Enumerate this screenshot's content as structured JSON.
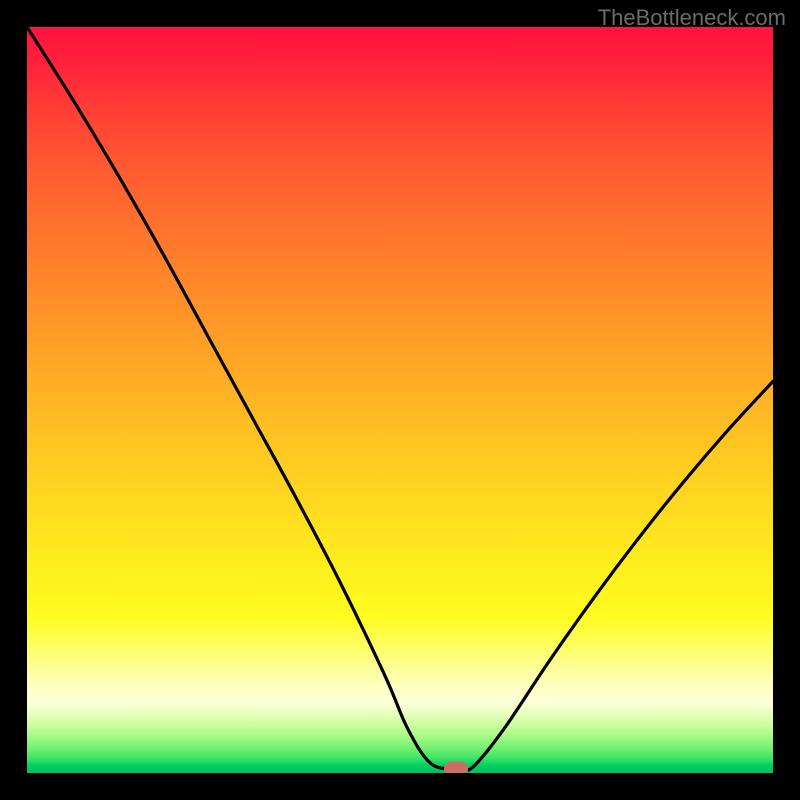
{
  "watermark": "TheBottleneck.com",
  "chart_data": {
    "type": "line",
    "title": "",
    "xlabel": "",
    "ylabel": "",
    "xlim": [
      0,
      1
    ],
    "ylim": [
      0,
      1
    ],
    "background_gradient": {
      "direction": "top-to-bottom",
      "top": "#ff133f",
      "bottom": "#00c15c",
      "meaning": "red=high bottleneck, green=low bottleneck"
    },
    "series": [
      {
        "name": "bottleneck-curve",
        "x": [
          0.0,
          0.06,
          0.12,
          0.18,
          0.24,
          0.3,
          0.36,
          0.42,
          0.48,
          0.51,
          0.54,
          0.57,
          0.585,
          0.6,
          0.64,
          0.7,
          0.76,
          0.82,
          0.88,
          0.94,
          1.0
        ],
        "y": [
          1.0,
          0.905,
          0.805,
          0.7,
          0.59,
          0.48,
          0.37,
          0.255,
          0.13,
          0.06,
          0.014,
          0.005,
          0.005,
          0.01,
          0.06,
          0.15,
          0.235,
          0.315,
          0.39,
          0.46,
          0.525
        ]
      }
    ],
    "marker": {
      "x": 0.575,
      "y": 0.006,
      "color": "#cc6e66"
    }
  }
}
